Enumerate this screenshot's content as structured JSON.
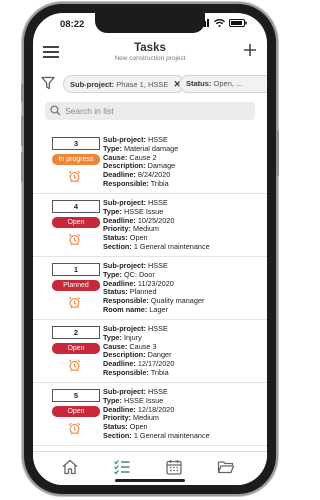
{
  "status_bar": {
    "time": "08:22"
  },
  "header": {
    "title": "Tasks",
    "subtitle": "New construction project"
  },
  "filters": [
    {
      "label": "Sub-project:",
      "value": "Phase 1, HSSE"
    },
    {
      "label": "Status:",
      "value": "Open, ..."
    }
  ],
  "search": {
    "placeholder": "Search in list"
  },
  "tasks": [
    {
      "id": "3",
      "status": "In progress",
      "status_color": "#f0853a",
      "fields": [
        {
          "label": "Sub-project:",
          "value": "HSSE"
        },
        {
          "label": "Type:",
          "value": "Material damage"
        },
        {
          "label": "Cause:",
          "value": "Cause 2"
        },
        {
          "label": "Description:",
          "value": "Damage"
        },
        {
          "label": "Deadline:",
          "value": "8/24/2020"
        },
        {
          "label": "Responsible:",
          "value": "Tribia"
        }
      ]
    },
    {
      "id": "4",
      "status": "Open",
      "status_color": "#c8283a",
      "fields": [
        {
          "label": "Sub-project:",
          "value": "HSSE"
        },
        {
          "label": "Type:",
          "value": "HSSE Issue"
        },
        {
          "label": "Deadline:",
          "value": "10/25/2020"
        },
        {
          "label": "Priority:",
          "value": "Medium"
        },
        {
          "label": "Status:",
          "value": "Open"
        },
        {
          "label": "Section:",
          "value": "1 General maintenance"
        }
      ]
    },
    {
      "id": "1",
      "status": "Planned",
      "status_color": "#c8283a",
      "fields": [
        {
          "label": "Sub-project:",
          "value": "HSSE"
        },
        {
          "label": "Type:",
          "value": "QC: Door"
        },
        {
          "label": "Deadline:",
          "value": "11/23/2020"
        },
        {
          "label": "Status:",
          "value": "Planned"
        },
        {
          "label": "Responsible:",
          "value": "Quality manager"
        },
        {
          "label": "Room name:",
          "value": "Lager"
        }
      ]
    },
    {
      "id": "2",
      "status": "Open",
      "status_color": "#c8283a",
      "fields": [
        {
          "label": "Sub-project:",
          "value": "HSSE"
        },
        {
          "label": "Type:",
          "value": "Injury"
        },
        {
          "label": "Cause:",
          "value": "Cause 3"
        },
        {
          "label": "Description:",
          "value": "Danger"
        },
        {
          "label": "Deadline:",
          "value": "12/17/2020"
        },
        {
          "label": "Responsible:",
          "value": "Tribia"
        }
      ]
    },
    {
      "id": "5",
      "status": "Open",
      "status_color": "#c8283a",
      "fields": [
        {
          "label": "Sub-project:",
          "value": "HSSE"
        },
        {
          "label": "Type:",
          "value": "HSSE Issue"
        },
        {
          "label": "Deadline:",
          "value": "12/18/2020"
        },
        {
          "label": "Priority:",
          "value": "Medium"
        },
        {
          "label": "Status:",
          "value": "Open"
        },
        {
          "label": "Section:",
          "value": "1 General maintenance"
        }
      ]
    }
  ],
  "tabbar": [
    {
      "icon": "home-icon"
    },
    {
      "icon": "checklist-icon",
      "active": true
    },
    {
      "icon": "calendar-icon"
    },
    {
      "icon": "folder-icon"
    }
  ],
  "colors": {
    "accent": "#4a8a78",
    "open": "#c8283a",
    "in_progress": "#f0853a",
    "alarm": "#f0853a"
  }
}
